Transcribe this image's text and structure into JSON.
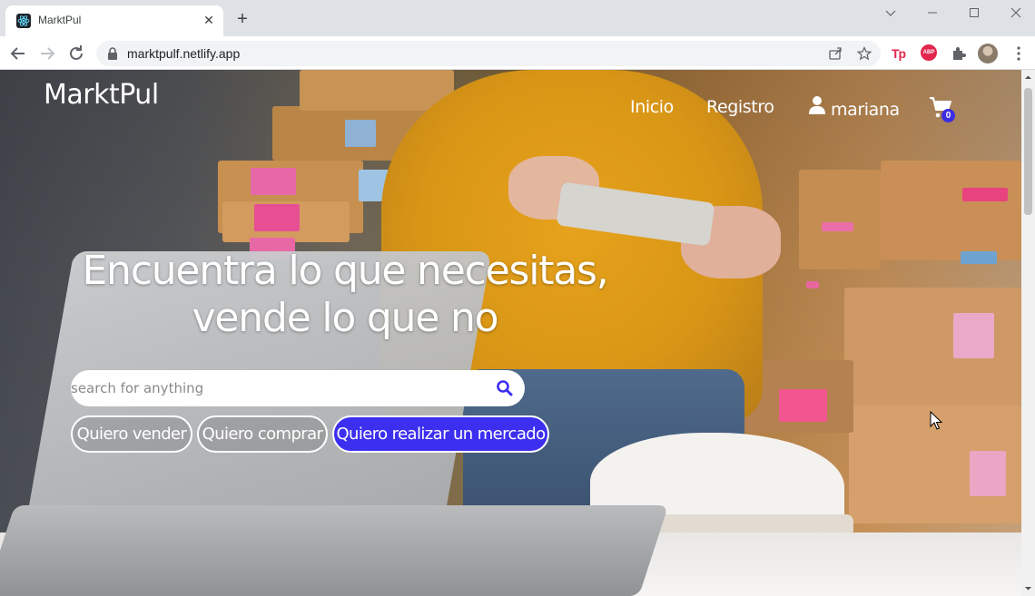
{
  "browser": {
    "tab_title": "MarktPul",
    "tab_close": "✕",
    "new_tab": "+",
    "url": "marktpulf.netlify.app",
    "window_controls": {
      "dropdown": "⌄",
      "minimize": "—",
      "maximize": "☐",
      "close": "✕"
    },
    "extensions": [
      "Tp",
      "ABP"
    ]
  },
  "site": {
    "brand": "MarktPul",
    "nav": {
      "home": "Inicio",
      "register": "Registro",
      "user": "mariana"
    },
    "cart_count": "0",
    "hero_line1": "Encuentra lo que necesitas,",
    "hero_line2": "vende lo que no",
    "search": {
      "placeholder": "search for anything",
      "value": ""
    },
    "buttons": {
      "sell": "Quiero vender",
      "buy": "Quiero comprar",
      "market": "Quiero realizar un mercado"
    }
  },
  "colors": {
    "accent": "#3d2ff0",
    "badge": "#3d2de0",
    "chrome_bg": "#dee1e6"
  },
  "icons": [
    "react-favicon-icon",
    "back-arrow-icon",
    "forward-arrow-icon",
    "reload-icon",
    "lock-icon",
    "share-icon",
    "star-icon",
    "puzzle-icon",
    "avatar",
    "menu-dots-icon",
    "user-icon",
    "cart-icon",
    "search-icon"
  ]
}
